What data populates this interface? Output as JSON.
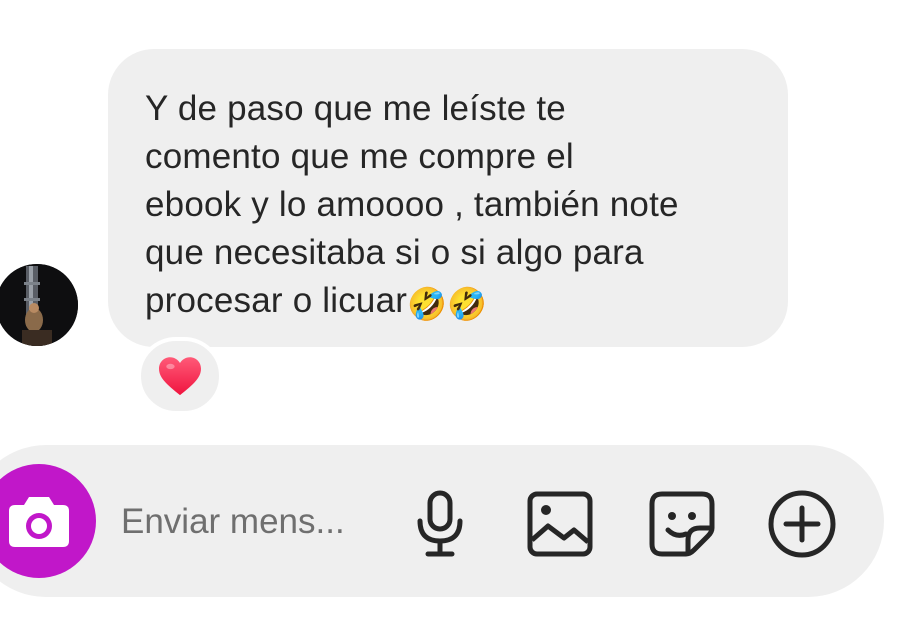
{
  "conversation": {
    "received_message": {
      "text": "Y de paso que me leíste te\ncomento que me compre el\nebook y lo amoooo , también note\nque necesitaba si o si algo para\nprocesar o licuar",
      "trailing_emojis": "🤣🤣",
      "reaction": "heart"
    },
    "sender_avatar": "avatar-photo"
  },
  "composer": {
    "camera_icon": "camera-icon",
    "placeholder": "Enviar mens...",
    "value": "",
    "actions": [
      {
        "icon": "microphone-icon"
      },
      {
        "icon": "gallery-icon"
      },
      {
        "icon": "sticker-icon"
      },
      {
        "icon": "plus-circle-icon"
      }
    ]
  },
  "colors": {
    "bubble_bg": "#efefef",
    "text": "#262626",
    "camera_bg": "#c117c9",
    "heart": "#ff2a55",
    "placeholder": "#6f6f6f"
  }
}
